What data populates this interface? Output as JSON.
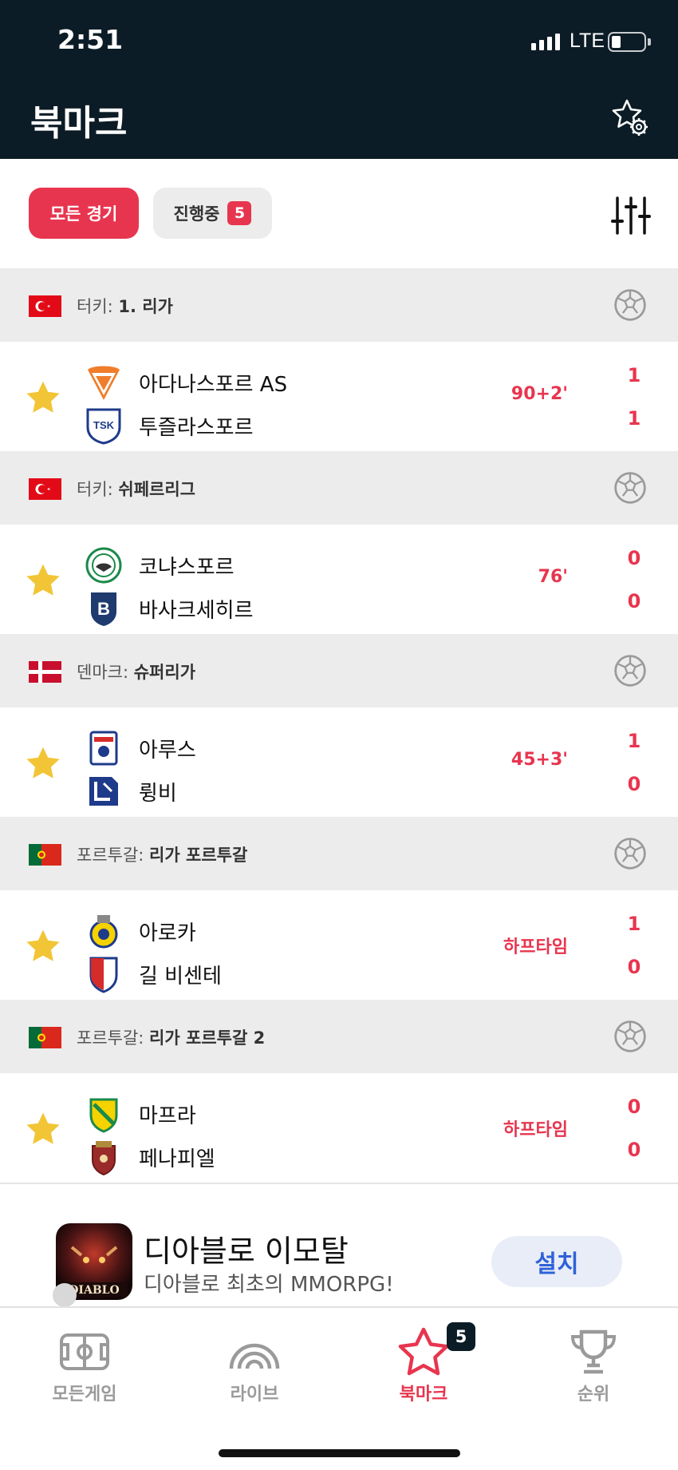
{
  "status_bar": {
    "time": "2:51",
    "network": "LTE"
  },
  "header": {
    "title": "북마크"
  },
  "filters": {
    "all": "모든 경기",
    "live": "진행중",
    "live_count": "5"
  },
  "colors": {
    "accent": "#e8354f",
    "header_bg": "#0c1c26",
    "star": "#f2c537",
    "install_blue": "#2f62d8"
  },
  "leagues": [
    {
      "country": "터키",
      "league": "1. 리가",
      "flag": "turkey"
    },
    {
      "country": "터키",
      "league": "쉬페르리그",
      "flag": "turkey"
    },
    {
      "country": "덴마크",
      "league": "슈퍼리가",
      "flag": "denmark"
    },
    {
      "country": "포르투갈",
      "league": "리가 포르투갈",
      "flag": "portugal"
    },
    {
      "country": "포르투갈",
      "league": "리가 포르투갈 2",
      "flag": "portugal"
    }
  ],
  "matches": [
    {
      "home": "아다나스포르 AS",
      "away": "투즐라스포르",
      "time": "90+2'",
      "home_score": "1",
      "away_score": "1"
    },
    {
      "home": "코냐스포르",
      "away": "바사크세히르",
      "time": "76'",
      "home_score": "0",
      "away_score": "0"
    },
    {
      "home": "아루스",
      "away": "륑비",
      "time": "45+3'",
      "home_score": "1",
      "away_score": "0"
    },
    {
      "home": "아로카",
      "away": "길 비센테",
      "time": "하프타임",
      "home_score": "1",
      "away_score": "0"
    },
    {
      "home": "마프라",
      "away": "페나피엘",
      "time": "하프타임",
      "home_score": "0",
      "away_score": "0"
    }
  ],
  "ad": {
    "title": "디아블로 이모탈",
    "subtitle": "디아블로 최초의 MMORPG!",
    "button": "설치",
    "icon_text": "DIABLO"
  },
  "tabs": [
    {
      "label": "모든게임",
      "icon": "field-icon"
    },
    {
      "label": "라이브",
      "icon": "live-icon"
    },
    {
      "label": "북마크",
      "icon": "star-icon",
      "badge": "5"
    },
    {
      "label": "순위",
      "icon": "trophy-icon"
    }
  ]
}
